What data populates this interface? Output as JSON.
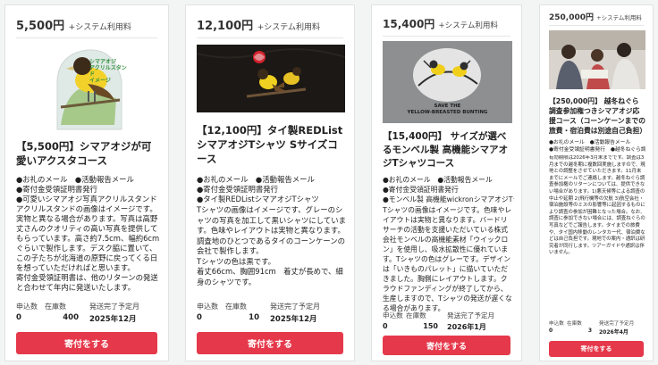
{
  "fee_label": "+システム利用料",
  "stat_labels": {
    "supporters": "申込数",
    "stock": "在庫数",
    "shipping": "発送完了予定月"
  },
  "cards": [
    {
      "price": "5,500円",
      "title": "【5,500円】シマアオジが可愛いアクスタコース",
      "items": [
        "●お礼のメール　●活動報告メール",
        "●寄付金受領証明書発行"
      ],
      "desc": "●可愛いシマアオジ写真アクリルスタンド\nアクリルスタンドの画像はイメージです。実物と異なる場合があります。写真は高野丈さんのクオリティの高い写真を提供してもらっています。高さ約7.5cm、幅約6cmぐらいで製作します。デスク脇に置いて、この子たちが北海道の原野に戻ってくる日を想っていただければと思います。\n寄付金受領証明書は、他のリターンの発送と合わせて年内に発送いたします。",
      "stats": {
        "supporters": "0",
        "stock": "400",
        "shipping": "2025年12月"
      },
      "button": "寄付をする",
      "image_text": [
        "シマアオジ",
        "アクリルスタンド",
        "イメージ"
      ]
    },
    {
      "price": "12,100円",
      "title": "【12,100円】タイ製REDListシマアオジTシャツ Sサイズコース",
      "items": [
        "●お礼のメール　●活動報告メール",
        "●寄付金受領証明書発行",
        "●タイ製REDListシマアオジTシャツ"
      ],
      "desc": "Tシャツの画像はイメージです、グレーのシャツの写真を加工して黒いシャツにしています。色味やレイアウトは実物と異なります。調査地のひとつであるタイのコーンケーンの会社で製作します。\nTシャツの色は黒です。\n着丈66cm、胸囲91cm　着丈が長めで、細身のシャツです。",
      "stats": {
        "supporters": "0",
        "stock": "10",
        "shipping": "2025年12月"
      },
      "button": "寄付をする"
    },
    {
      "price": "15,400円",
      "title": "【15,400円】 サイズが選べるモンベル製 高機能シマアオジTシャツコース",
      "items": [
        "●お礼のメール　●活動報告メール",
        "●寄付金受領証明書発行",
        "●モンベル製 高機能wickronシマアオジTシャツ"
      ],
      "desc": "Tシャツの画像はイメージです。色味やレイアウトは実物と異なります。バードリサーチの活動を支援いただいている株式会社モンベルの高機能素材「ウイックロン」を使用し、吸水拡散性に優れています。Tシャツの色はグレーです。デザインは「いきものパレット」に描いていただきました。胸側にレイアウトします。クラウドファンディングが終了してから、生産しますので、Tシャツの発送が遅くなる場合があります。",
      "stats": {
        "supporters": "0",
        "stock": "150",
        "shipping": "2026年1月"
      },
      "button": "寄付をする",
      "image_text": [
        "SAVE THE",
        "YELLOW-BREASTED BUNTING"
      ]
    },
    {
      "price": "250,000円",
      "title": "【250,000円】 越冬ねぐら調査参加権つきシマアオジ応援コース（コーンケーンまでの旅費・宿泊費は別途自己負担）",
      "items": [
        "●お礼のメール　●活動報告メール",
        "●寄付金受領証明書発行　●越冬ねぐら調査への参加"
      ],
      "desc": "有効期限は2026年3月末までです。調査は3月までの越冬期に複数回実施しますので、現地との調整をさせていただきます。11月末までにメールでご連絡します。越冬ねぐら調査参加権のリターンについては、提供できない場合があります。1)悪天候等による調査の中止や延期 2)飛行機等の欠航 3)航空会社・宿泊施設等のミスの影響等に起因するものにより調査の参加が困難となった場合。なお、調査に参加できない場合には、調査ねぐらの写真などでご報告します。タイまでの旅費や、タイ国内移動のレンタカー代、宿泊費などは自己負担です。現地での案内・通訳は研究者が同行します。ツアーガイドや通訳は伴いません。",
      "stats": {
        "supporters": "0",
        "stock": "3",
        "shipping": "2026年4月"
      },
      "button": "寄付をする"
    }
  ]
}
